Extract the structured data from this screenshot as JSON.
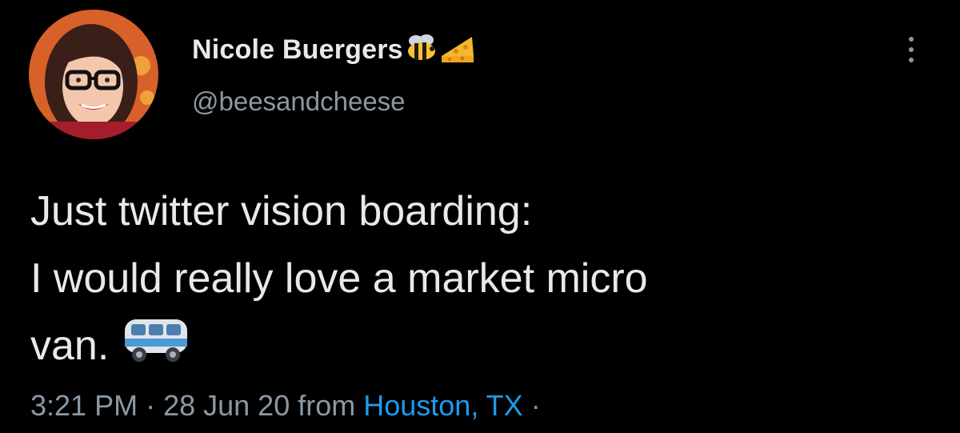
{
  "author": {
    "display_name": "Nicole Buergers",
    "handle": "@beesandcheese",
    "name_emojis": [
      "bee-emoji",
      "cheese-emoji"
    ]
  },
  "tweet": {
    "lines": [
      "Just twitter vision boarding:",
      "I would really love a market micro",
      "van."
    ],
    "trailing_emoji": "minibus-emoji"
  },
  "meta": {
    "time": "3:21 PM",
    "sep1": " · ",
    "date": "28 Jun 20",
    "from_label": " from ",
    "location": "Houston, TX",
    "sep2": " ·"
  },
  "colors": {
    "background": "#000000",
    "text": "#e7e9ea",
    "secondary": "#8b98a5",
    "link": "#1d9bf0"
  }
}
